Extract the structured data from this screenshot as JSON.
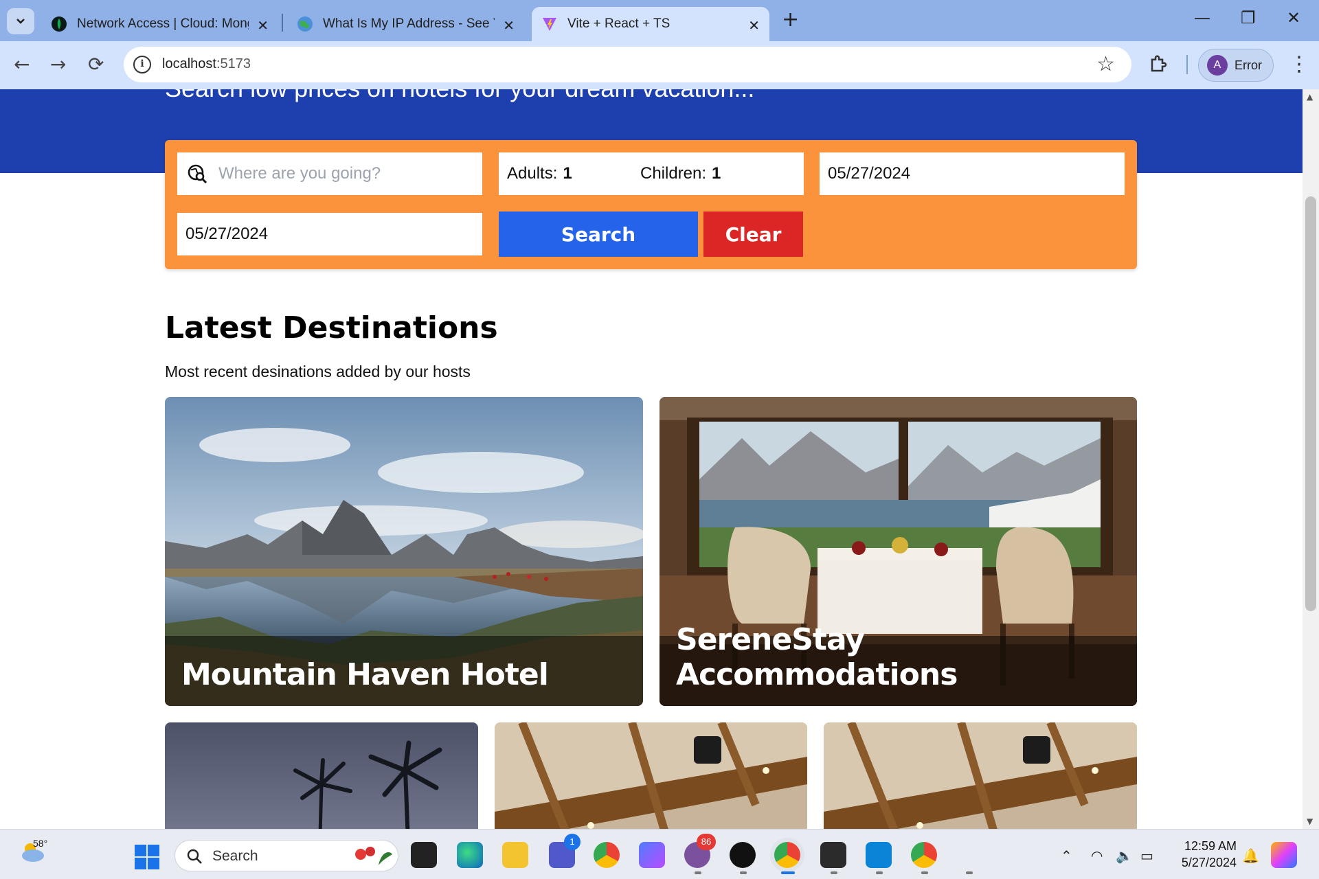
{
  "browser": {
    "tabs": [
      {
        "title": "Network Access | Cloud: MongoDB",
        "favicon": "mongodb-leaf-icon",
        "active": false
      },
      {
        "title": "What Is My IP Address - See Your",
        "favicon": "globe-icon",
        "active": false
      },
      {
        "title": "Vite + React + TS",
        "favicon": "vite-icon",
        "active": true
      }
    ],
    "address": {
      "host": "localhost",
      "port": ":5173"
    },
    "profile_label": "Error",
    "profile_initial": "A"
  },
  "hero": {
    "tagline": "Search low prices on hotels for your dream vacation..."
  },
  "search": {
    "destination_placeholder": "Where are you going?",
    "adults_label": "Adults:",
    "adults_value": "1",
    "children_label": "Children:",
    "children_value": "1",
    "check_in": "05/27/2024",
    "check_out": "05/27/2024",
    "search_label": "Search",
    "clear_label": "Clear"
  },
  "destinations": {
    "title": "Latest Destinations",
    "subtitle": "Most recent desinations added by our hosts",
    "cards": [
      {
        "name": "Mountain Haven Hotel"
      },
      {
        "name": "SereneStay Accommodations"
      }
    ]
  },
  "taskbar": {
    "temperature": "58°",
    "search_label": "Search",
    "teams_badge": "1",
    "viber_badge": "86",
    "time": "12:59 AM",
    "date": "5/27/2024"
  },
  "colors": {
    "hero_bg": "#1e40af",
    "panel_bg": "#fb923c",
    "search_button": "#2563eb",
    "clear_button": "#dc2626"
  }
}
